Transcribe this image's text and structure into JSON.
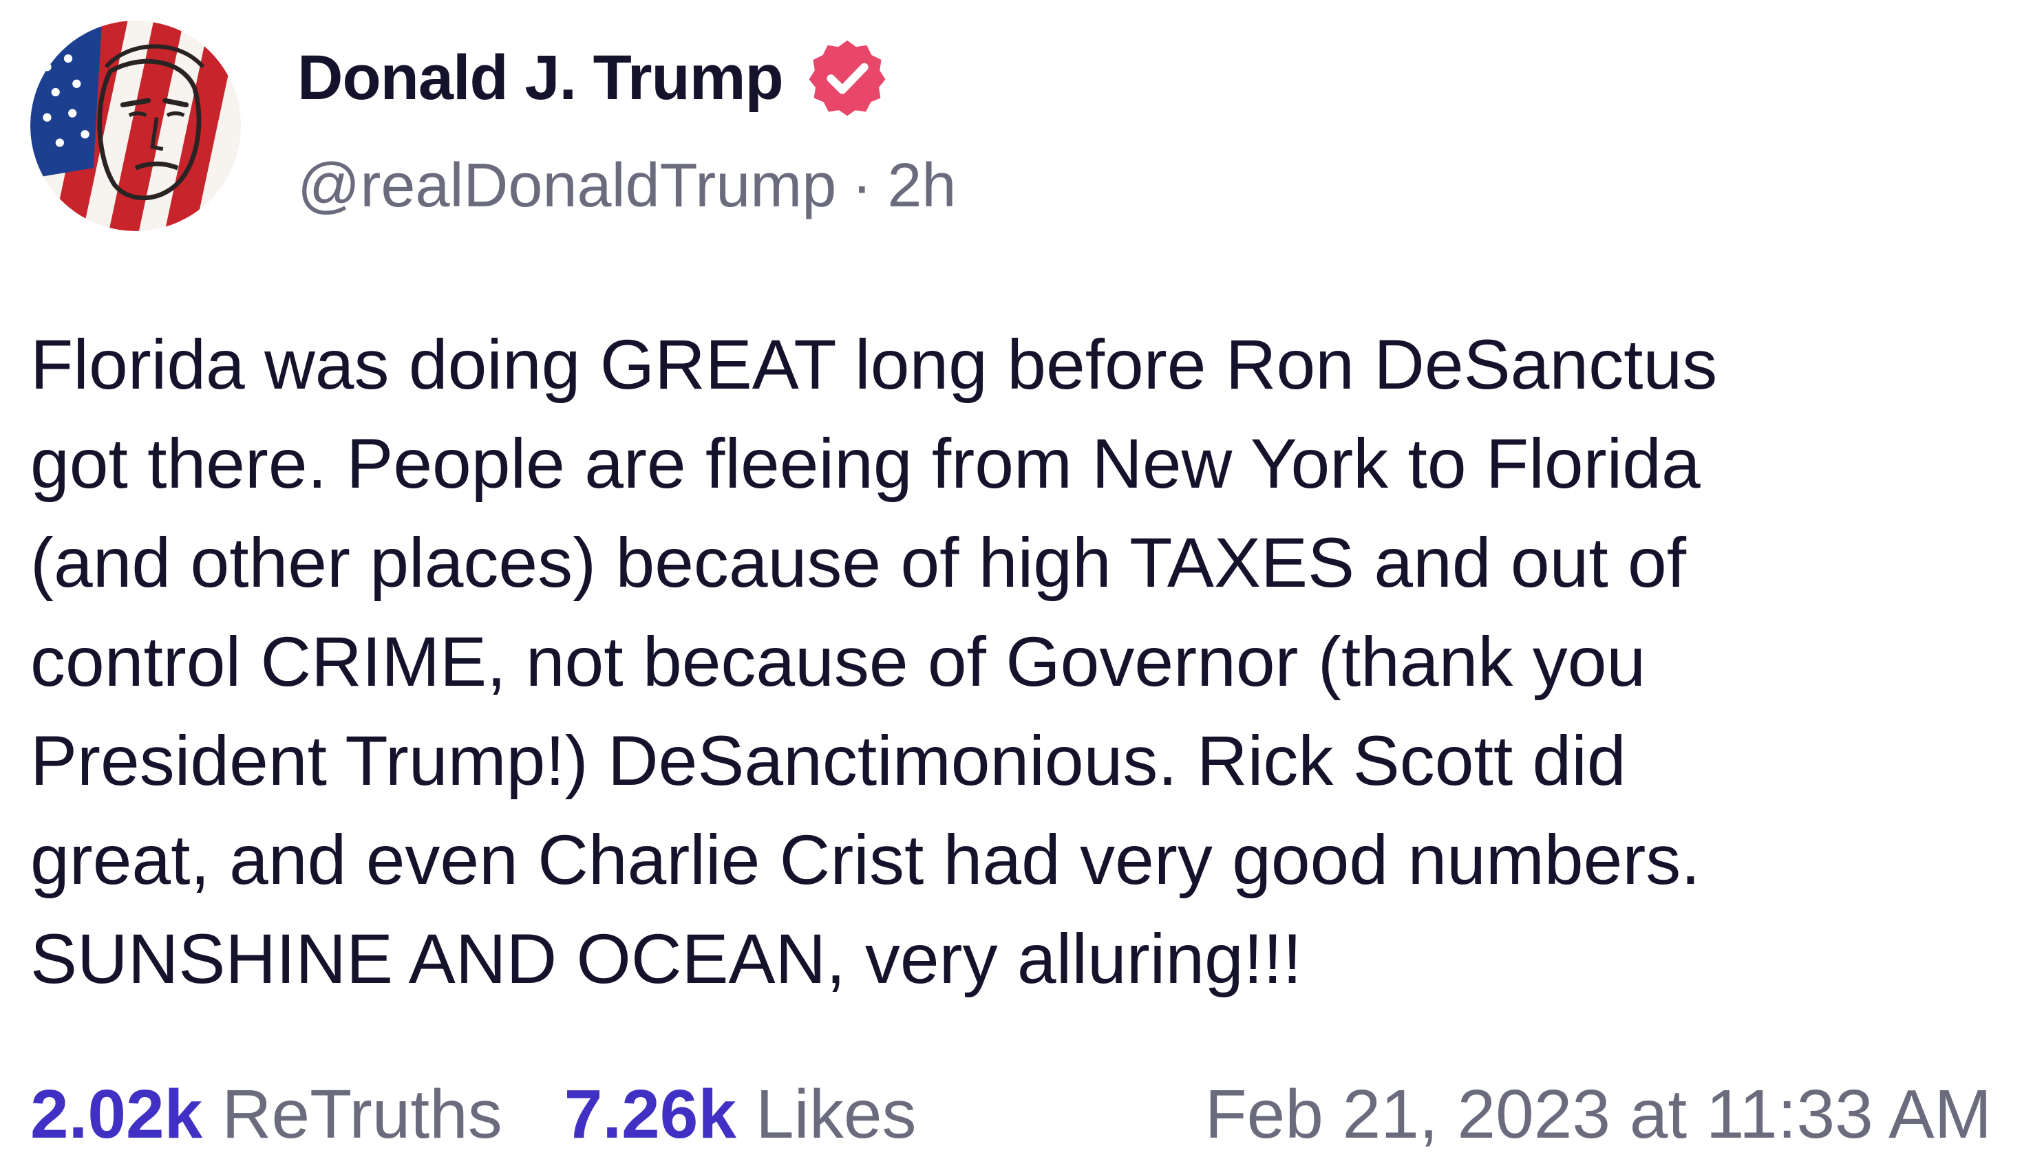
{
  "author": {
    "display_name": "Donald J. Trump",
    "handle": "@realDonaldTrump",
    "separator": "·",
    "relative_time": "2h",
    "verified": true
  },
  "post": {
    "text": "Florida was doing GREAT long before Ron DeSanctus\ngot there. People are fleeing from New York to Florida\n(and other places) because of high TAXES and out of\ncontrol CRIME, not because of Governor (thank you\nPresident Trump!) DeSanctimonious. Rick Scott did\ngreat, and even Charlie Crist had very good numbers.\nSUNSHINE AND OCEAN, very alluring!!!"
  },
  "stats": {
    "retruths_count": "2.02k",
    "retruths_label": "ReTruths",
    "likes_count": "7.26k",
    "likes_label": "Likes",
    "timestamp": "Feb 21, 2023 at 11:33 AM"
  },
  "colors": {
    "accent": "#4030c4",
    "verified_badge": "#e8476a",
    "text_primary": "#14132b",
    "text_secondary": "#6b6b7e"
  },
  "icons": {
    "avatar": "flag-painted-portrait-avatar",
    "verified": "verified-badge-icon"
  }
}
